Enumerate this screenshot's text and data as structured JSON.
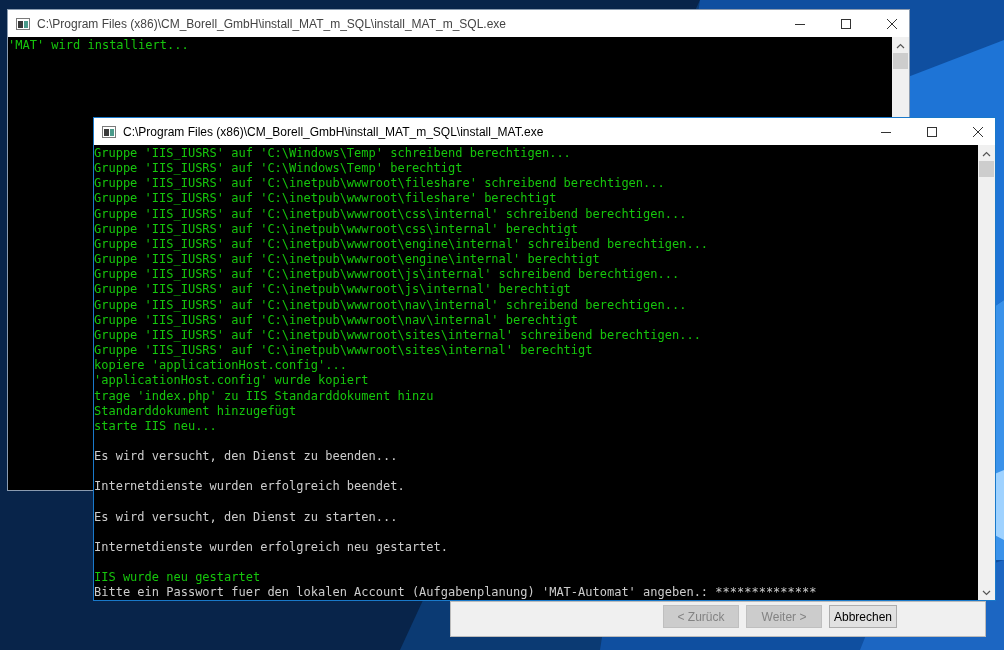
{
  "windows": [
    {
      "title": "C:\\Program Files (x86)\\CM_Borell_GmbH\\install_MAT_m_SQL\\install_MAT_m_SQL.exe",
      "active": false,
      "lines": [
        {
          "text": "'MAT' wird installiert...",
          "kind": "script"
        }
      ]
    },
    {
      "title": "C:\\Program Files (x86)\\CM_Borell_GmbH\\install_MAT_m_SQL\\install_MAT.exe",
      "active": true,
      "lines": [
        {
          "text": "Gruppe 'IIS_IUSRS' auf 'C:\\Windows\\Temp' schreibend berechtigen...",
          "kind": "script"
        },
        {
          "text": "Gruppe 'IIS_IUSRS' auf 'C:\\Windows\\Temp' berechtigt",
          "kind": "script"
        },
        {
          "text": "Gruppe 'IIS_IUSRS' auf 'C:\\inetpub\\wwwroot\\fileshare' schreibend berechtigen...",
          "kind": "script"
        },
        {
          "text": "Gruppe 'IIS_IUSRS' auf 'C:\\inetpub\\wwwroot\\fileshare' berechtigt",
          "kind": "script"
        },
        {
          "text": "Gruppe 'IIS_IUSRS' auf 'C:\\inetpub\\wwwroot\\css\\internal' schreibend berechtigen...",
          "kind": "script"
        },
        {
          "text": "Gruppe 'IIS_IUSRS' auf 'C:\\inetpub\\wwwroot\\css\\internal' berechtigt",
          "kind": "script"
        },
        {
          "text": "Gruppe 'IIS_IUSRS' auf 'C:\\inetpub\\wwwroot\\engine\\internal' schreibend berechtigen...",
          "kind": "script"
        },
        {
          "text": "Gruppe 'IIS_IUSRS' auf 'C:\\inetpub\\wwwroot\\engine\\internal' berechtigt",
          "kind": "script"
        },
        {
          "text": "Gruppe 'IIS_IUSRS' auf 'C:\\inetpub\\wwwroot\\js\\internal' schreibend berechtigen...",
          "kind": "script"
        },
        {
          "text": "Gruppe 'IIS_IUSRS' auf 'C:\\inetpub\\wwwroot\\js\\internal' berechtigt",
          "kind": "script"
        },
        {
          "text": "Gruppe 'IIS_IUSRS' auf 'C:\\inetpub\\wwwroot\\nav\\internal' schreibend berechtigen...",
          "kind": "script"
        },
        {
          "text": "Gruppe 'IIS_IUSRS' auf 'C:\\inetpub\\wwwroot\\nav\\internal' berechtigt",
          "kind": "script"
        },
        {
          "text": "Gruppe 'IIS_IUSRS' auf 'C:\\inetpub\\wwwroot\\sites\\internal' schreibend berechtigen...",
          "kind": "script"
        },
        {
          "text": "Gruppe 'IIS_IUSRS' auf 'C:\\inetpub\\wwwroot\\sites\\internal' berechtigt",
          "kind": "script"
        },
        {
          "text": "kopiere 'applicationHost.config'...",
          "kind": "script"
        },
        {
          "text": "'applicationHost.config' wurde kopiert",
          "kind": "script"
        },
        {
          "text": "trage 'index.php' zu IIS Standarddokument hinzu",
          "kind": "script"
        },
        {
          "text": "Standarddokument hinzugefügt",
          "kind": "script"
        },
        {
          "text": "starte IIS neu...",
          "kind": "script"
        },
        {
          "text": "Es wird versucht, den Dienst zu beenden...",
          "kind": "system",
          "blank_before": true
        },
        {
          "text": "Internetdienste wurden erfolgreich beendet.",
          "kind": "system",
          "blank_before": true
        },
        {
          "text": "Es wird versucht, den Dienst zu starten...",
          "kind": "system",
          "blank_before": true
        },
        {
          "text": "Internetdienste wurden erfolgreich neu gestartet.",
          "kind": "system",
          "blank_before": true
        },
        {
          "text": "IIS wurde neu gestartet",
          "kind": "script",
          "blank_before": true
        },
        {
          "text": "Bitte ein Passwort fuer den lokalen Account (Aufgabenplanung) 'MAT-Automat' angeben.: **************",
          "kind": "system"
        }
      ]
    }
  ],
  "wizard": {
    "buttons": [
      {
        "label": "< Zurück",
        "disabled": true
      },
      {
        "label": "Weiter >",
        "disabled": true
      },
      {
        "label": "Abbrechen",
        "disabled": false
      }
    ]
  }
}
